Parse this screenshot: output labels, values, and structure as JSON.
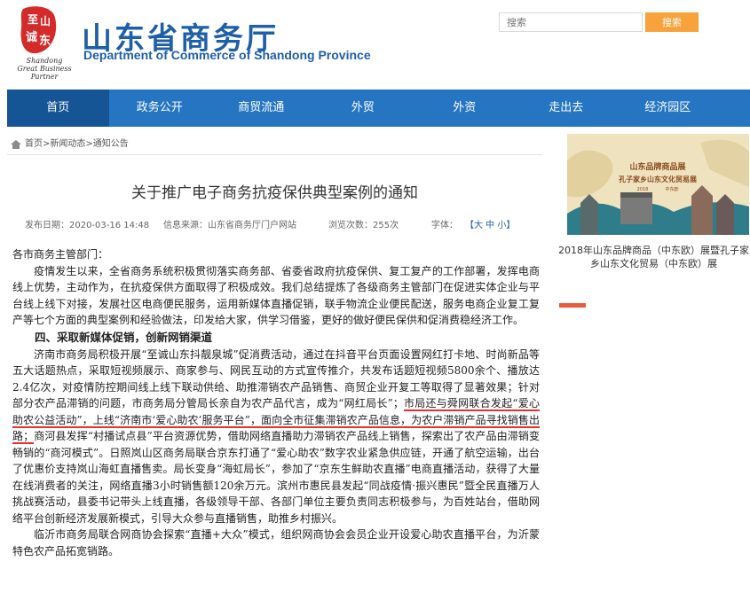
{
  "header": {
    "logo_text_lines": [
      "Shandong",
      "Great Business Partner"
    ],
    "logo_seal_chars": [
      "至",
      "诚",
      "山",
      "东"
    ],
    "title": "山东省商务厅",
    "subtitle": "Department of Commerce of Shandong Province",
    "search_placeholder": "搜索",
    "search_button": "搜索"
  },
  "nav": {
    "items": [
      {
        "label": "首页",
        "active": true
      },
      {
        "label": "政务公开"
      },
      {
        "label": "商贸流通"
      },
      {
        "label": "外贸"
      },
      {
        "label": "外资"
      },
      {
        "label": "走出去"
      },
      {
        "label": "经济园区"
      }
    ]
  },
  "breadcrumb": {
    "home": "首页",
    "sep": ">",
    "news": "新闻动态",
    "notices": "通知公告"
  },
  "article": {
    "title": "关于推广电子商务抗疫保供典型案例的通知",
    "date": "发布日期：2020-03-16 14:48",
    "source": "信息来源：山东省商务厅门户网站",
    "views": "浏览次数：255次",
    "font_label": "字体：",
    "font_size": "【大 中 小】",
    "salutation": "各市商务主管部门：",
    "para1": "疫情发生以来，全省商务系统积极贯彻落实商务部、省委省政府抗疫保供、复工复产的工作部署，发挥电商线上优势，主动作为，在抗疫保供方面取得了积极成效。我们总结提炼了各级商务主管部门在促进实体企业与平台线上线下对接，发展社区电商便民服务，运用新媒体直播促销，联手物流企业便民配送，服务电商企业复工复产等七个方面的典型案例和经验做法，印发给大家，供学习借鉴，更好的做好便民保供和促消费稳经济工作。",
    "heading4": "四、采取新媒体促销，创新网销渠道",
    "para2_a": "济南市商务局积极开展“至诚山东抖靓泉城”促消费活动，通过在抖音平台页面设置网红打卡地、时尚新品等五大话题热点，采取短视频展示、商家参与、网民互动的方式宣传推介，共发布话题短视频5800余个、播放达2.4亿次，对疫情防控期间线上线下联动供给、助推滞销农产品销售、商贸企业开复工等取得了显著效果；针对部分农产品滞销的问题，市商务局分管局长亲自为农产品代言，成为“网红局长”；",
    "para2_hl": "市局还与舜网联合发起“爱心助农公益活动”，上线“济南市‘爱心助农’服务平台”，面向全市征集滞销农产品信息，为农户滞销产品寻找销售出路；",
    "para2_b": "商河县发挥“村播试点县”平台资源优势，借助网络直播助力滞销农产品线上销售，探索出了农产品由滞销变畅销的“商河模式”。日照岚山区商务局联合京东打通了“爱心助农”数字农业紧急供应链，开通了航空运输，出台了优惠价支持岚山海虹直播售卖。局长变身“海虹局长”，参加了“京东生鲜助农直播”电商直播活动，获得了大量在线消费者的关注，网络直播3小时销售额120余万元。滨州市惠民县发起“同战疫情·振兴惠民”暨全民直播万人挑战赛活动，县委书记带头上线直播，各级领导干部、各部门单位主要负责同志积极参与，为百姓站台，借助网络平台创新经济发展新模式，引导大众参与直播销售，助推乡村振兴。",
    "para3": "临沂市商务局联合网商协会探索“直播+大众”模式，组织网商协会会员企业开设爱心助农直播平台，为沂蒙特色农产品拓宽销路。"
  },
  "sidebar": {
    "ad_image_lines": [
      "山东品牌商品展",
      "孔子家乡山东文化贸易展",
      "2018",
      "中东欧"
    ],
    "ad_caption": "2018年山东品牌商品（中东欧）展暨孔子家乡山东文化贸易（中东欧）展"
  },
  "colors": {
    "brand_blue": "#1f5fa8",
    "nav_blue": "#2575c2",
    "nav_active": "#155596",
    "search_orange": "#f7a23b",
    "highlight_red": "#e83030"
  }
}
